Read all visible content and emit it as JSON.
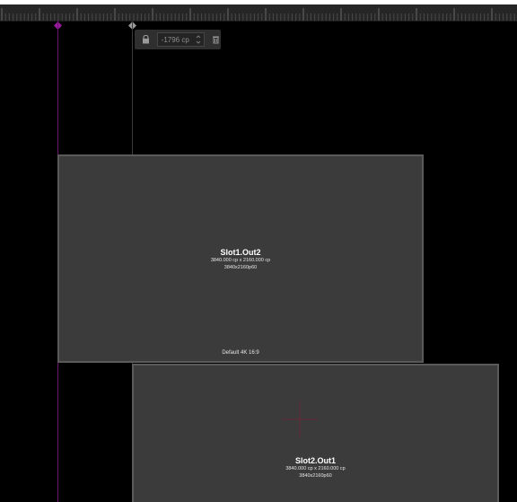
{
  "guide_tooltip": {
    "lock_icon": "lock-icon",
    "position_value": "-1796 cp",
    "delete_icon": "trash-icon"
  },
  "outputs": [
    {
      "name": "Slot1.Out2",
      "size": "3840.000 cp x 2160.000 cp",
      "format": "3840x2160p60",
      "footer": "Default 4K 16:9"
    },
    {
      "name": "Slot2.Out1",
      "size": "3840.000 cp x 2160.000 cp",
      "format": "3840x2160p60"
    }
  ],
  "colors": {
    "canvas": "#000000",
    "ruler": "#262626",
    "guide_magenta": "#6d1470",
    "panel_fill": "#3b3b3b",
    "panel_border": "#5a5a5a",
    "crosshair": "#6a2a3a"
  }
}
